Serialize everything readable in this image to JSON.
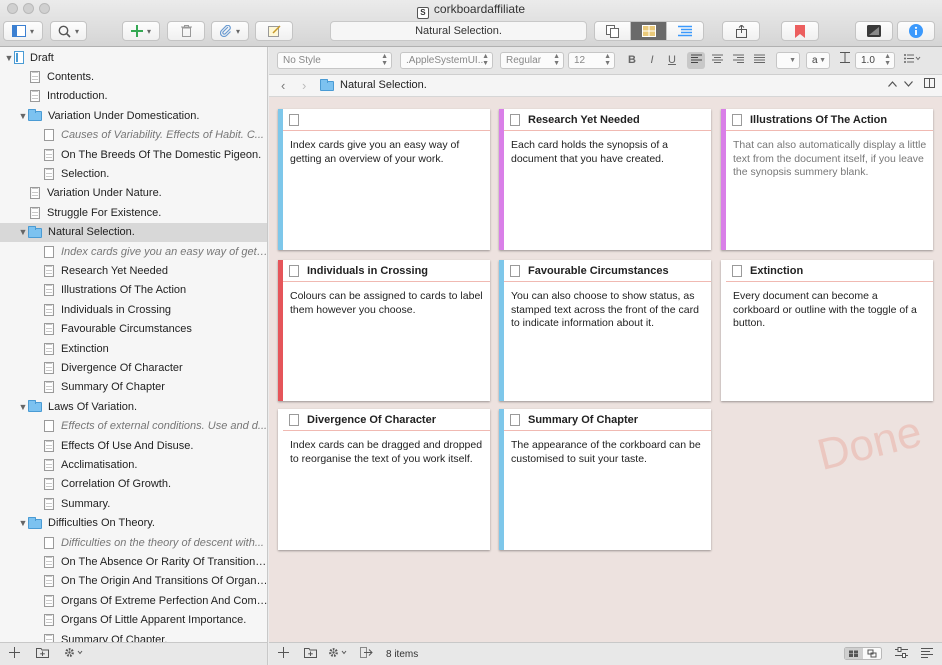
{
  "window": {
    "title": "corkboardaffiliate"
  },
  "toolbar": {
    "document_title": "Natural Selection.",
    "icons": [
      "sidebar-toggle-icon",
      "search-icon",
      "plus-icon",
      "trash-icon",
      "paperclip-icon",
      "note-icon",
      "copy-icon",
      "corkboard-icon",
      "outline-icon",
      "share-icon",
      "bookmark-icon",
      "inspector-icon",
      "info-icon"
    ],
    "accent_color": "#3b99fc"
  },
  "format_bar": {
    "style": "No Style",
    "font": ".AppleSystemUI...",
    "weight": "Regular",
    "size": "12",
    "line_spacing": "1.0",
    "text_color_label": "a"
  },
  "header": {
    "title": "Natural Selection."
  },
  "binder": {
    "items": [
      {
        "label": "Draft",
        "level": 0,
        "kind": "draft",
        "expanded": true
      },
      {
        "label": "Contents.",
        "level": 1,
        "kind": "doc"
      },
      {
        "label": "Introduction.",
        "level": 1,
        "kind": "doc"
      },
      {
        "label": "Variation Under Domestication.",
        "level": 1,
        "kind": "folder",
        "expanded": true
      },
      {
        "label": "Causes of Variability. Effects of Habit. C...",
        "level": 2,
        "kind": "doc",
        "synopsis": true
      },
      {
        "label": "On The Breeds Of The Domestic Pigeon.",
        "level": 2,
        "kind": "doc"
      },
      {
        "label": "Selection.",
        "level": 2,
        "kind": "doc"
      },
      {
        "label": "Variation Under Nature.",
        "level": 1,
        "kind": "doc"
      },
      {
        "label": "Struggle For Existence.",
        "level": 1,
        "kind": "doc"
      },
      {
        "label": "Natural Selection.",
        "level": 1,
        "kind": "folder",
        "expanded": true,
        "selected": true
      },
      {
        "label": "Index cards give you an easy way of getti...",
        "level": 2,
        "kind": "doc",
        "synopsis": true
      },
      {
        "label": "Research Yet Needed",
        "level": 2,
        "kind": "doc"
      },
      {
        "label": "Illustrations Of The Action",
        "level": 2,
        "kind": "doc"
      },
      {
        "label": "Individuals in Crossing",
        "level": 2,
        "kind": "doc"
      },
      {
        "label": "Favourable Circumstances",
        "level": 2,
        "kind": "doc"
      },
      {
        "label": "Extinction",
        "level": 2,
        "kind": "doc"
      },
      {
        "label": "Divergence Of Character",
        "level": 2,
        "kind": "doc"
      },
      {
        "label": "Summary Of Chapter",
        "level": 2,
        "kind": "doc"
      },
      {
        "label": "Laws Of Variation.",
        "level": 1,
        "kind": "folder",
        "expanded": true
      },
      {
        "label": "Effects of external conditions. Use and d...",
        "level": 2,
        "kind": "doc",
        "synopsis": true
      },
      {
        "label": "Effects Of Use And Disuse.",
        "level": 2,
        "kind": "doc"
      },
      {
        "label": "Acclimatisation.",
        "level": 2,
        "kind": "doc"
      },
      {
        "label": "Correlation Of Growth.",
        "level": 2,
        "kind": "doc"
      },
      {
        "label": "Summary.",
        "level": 2,
        "kind": "doc"
      },
      {
        "label": "Difficulties On Theory.",
        "level": 1,
        "kind": "folder",
        "expanded": true
      },
      {
        "label": "Difficulties on the theory of descent with...",
        "level": 2,
        "kind": "doc",
        "synopsis": true
      },
      {
        "label": "On The Absence Or Rarity Of Transitiona...",
        "level": 2,
        "kind": "doc"
      },
      {
        "label": "On The Origin And Transitions Of Organi...",
        "level": 2,
        "kind": "doc"
      },
      {
        "label": "Organs Of Extreme Perfection And Comp...",
        "level": 2,
        "kind": "doc"
      },
      {
        "label": "Organs Of Little Apparent Importance.",
        "level": 2,
        "kind": "doc"
      },
      {
        "label": "Summary Of Chapter.",
        "level": 2,
        "kind": "doc"
      }
    ]
  },
  "corkboard": {
    "stamp": "Done",
    "cards": [
      {
        "title": "",
        "synopsis": "Index cards give you an easy way of getting an overview of your work.",
        "label_color": "#7ec7ea"
      },
      {
        "title": "Research Yet Needed",
        "synopsis": "Each card holds the synopsis of a document that you have created.",
        "label_color": "#d97fe8"
      },
      {
        "title": "Illustrations Of The Action",
        "synopsis": "That can also automatically display a little text from the document itself, if you leave the synopsis summery blank.",
        "label_color": "#d97fe8",
        "auto": true
      },
      {
        "title": "Individuals in Crossing",
        "synopsis": "Colours can be assigned to cards to label them however you choose.",
        "label_color": "#e5555a"
      },
      {
        "title": "Favourable Circumstances",
        "synopsis": "You can also choose to show status, as stamped text across the front of the card to indicate information about it.",
        "label_color": "#7ec7ea"
      },
      {
        "title": "Extinction",
        "synopsis": "Every document can become a corkboard or outline with the toggle of a button.",
        "label_color": ""
      },
      {
        "title": "Divergence Of Character",
        "synopsis": "Index cards can be dragged and dropped to reorganise the text of you work itself.",
        "label_color": ""
      },
      {
        "title": "Summary Of Chapter",
        "synopsis": "The appearance of the corkboard can be customised to suit your taste.",
        "label_color": "#7ec7ea"
      }
    ]
  },
  "footer": {
    "item_count": "8 items"
  }
}
